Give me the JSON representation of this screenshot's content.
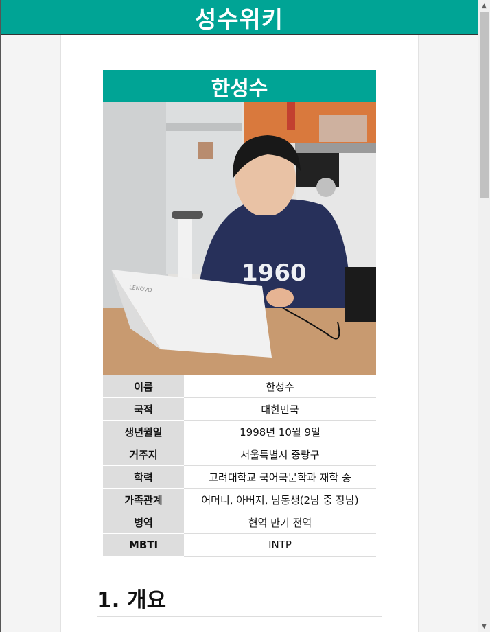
{
  "site": {
    "title": "성수위키"
  },
  "infobox": {
    "title": "한성수",
    "photo": {
      "sweater_text": "1960",
      "laptop_brand": "LENOVO"
    },
    "rows": [
      {
        "key": "이름",
        "value": "한성수"
      },
      {
        "key": "국적",
        "value": "대한민국"
      },
      {
        "key": "생년월일",
        "value": "1998년 10월 9일"
      },
      {
        "key": "거주지",
        "value": "서울특별시 중랑구"
      },
      {
        "key": "학력",
        "value": "고려대학교 국어국문학과 재학 중"
      },
      {
        "key": "가족관계",
        "value": "어머니, 아버지, 남동생(2남 중 장남)"
      },
      {
        "key": "병역",
        "value": "현역 만기 전역"
      },
      {
        "key": "MBTI",
        "value": "INTP"
      }
    ]
  },
  "sections": [
    {
      "title": "1. 개요"
    }
  ],
  "colors": {
    "brand": "#00a495",
    "key_cell": "#dddddd"
  },
  "icons": {
    "scroll_up": "triangle-up-icon",
    "scroll_down": "triangle-down-icon"
  }
}
